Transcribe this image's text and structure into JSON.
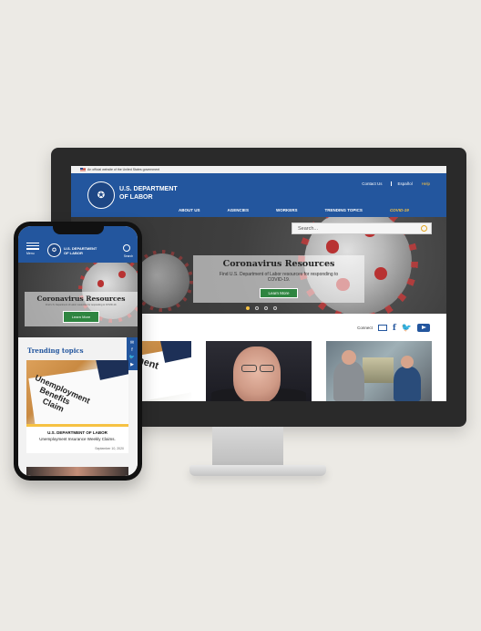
{
  "desktop": {
    "gov_banner": "An official website of the United States government",
    "agency_name_line1": "U.S. DEPARTMENT",
    "agency_name_line2": "OF LABOR",
    "utility_links": [
      "Contact Us",
      "Español",
      "Help"
    ],
    "nav_items": [
      "ABOUT US",
      "AGENCIES",
      "WORKERS",
      "TRENDING TOPICS",
      "COVID-19"
    ],
    "search_placeholder": "Search...",
    "hero_title": "Coronavirus Resources",
    "hero_text": "Find U.S. Department of Labor resources for responding to COVID-19.",
    "hero_button": "Learn More",
    "connect_label": "Connect",
    "photo1_text": "ment",
    "slide_count": 4,
    "active_slide": 1
  },
  "mobile": {
    "menu_label": "Menu",
    "agency_name_line1": "U.S. DEPARTMENT",
    "agency_name_line2": "OF LABOR",
    "search_label": "Search",
    "hero_title": "Coronavirus Resources",
    "hero_text": "Find U.S. Department of Labor resources for responding to COVID-19.",
    "hero_button": "Learn More",
    "trending_heading": "Trending topics",
    "card_image_text": [
      "Unemployment",
      "Benefits",
      "Claim"
    ],
    "card_title": "U.S. DEPARTMENT OF LABOR",
    "card_subtitle": "Unemployment Insurance Weekly Claims.",
    "card_date": "September 10, 2020"
  },
  "colors": {
    "brand_blue": "#23569e",
    "accent_gold": "#f6c243",
    "button_green": "#2e8540"
  }
}
